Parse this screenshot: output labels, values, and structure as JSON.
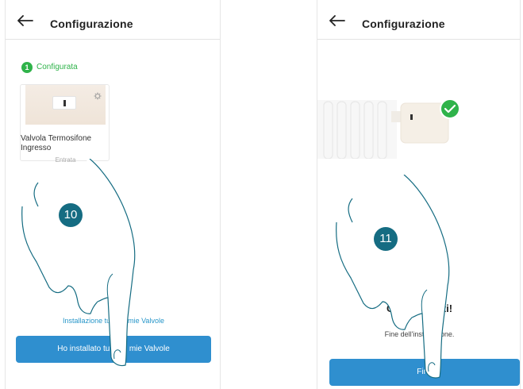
{
  "left_screen": {
    "header": {
      "back_icon": "arrow-left-icon",
      "title": "Configurazione"
    },
    "step": {
      "number": "1",
      "label": "Configurata"
    },
    "device": {
      "name": "Valvola Termosifone Ingresso",
      "room": "Entrata",
      "icons": [
        "valve-image",
        "gear-icon"
      ]
    },
    "hint_link": "Installazione tutte le mie Valvole",
    "primary_button": "Ho installato tutte le mie Valvole"
  },
  "right_screen": {
    "header": {
      "back_icon": "arrow-left-icon",
      "title": "Configurazione"
    },
    "success_title": "Complimenti!",
    "success_subtitle": "Fine dell'installazione.",
    "primary_button": "Fine",
    "icons": [
      "radiator-image",
      "valve-image",
      "check-circle-icon"
    ]
  },
  "annotations": {
    "left_marker": "10",
    "right_marker": "11",
    "marker_color": "#156c82"
  },
  "colors": {
    "accent_blue": "#2f8fcf",
    "success_green": "#2fb34a",
    "link_blue": "#2796c9"
  }
}
